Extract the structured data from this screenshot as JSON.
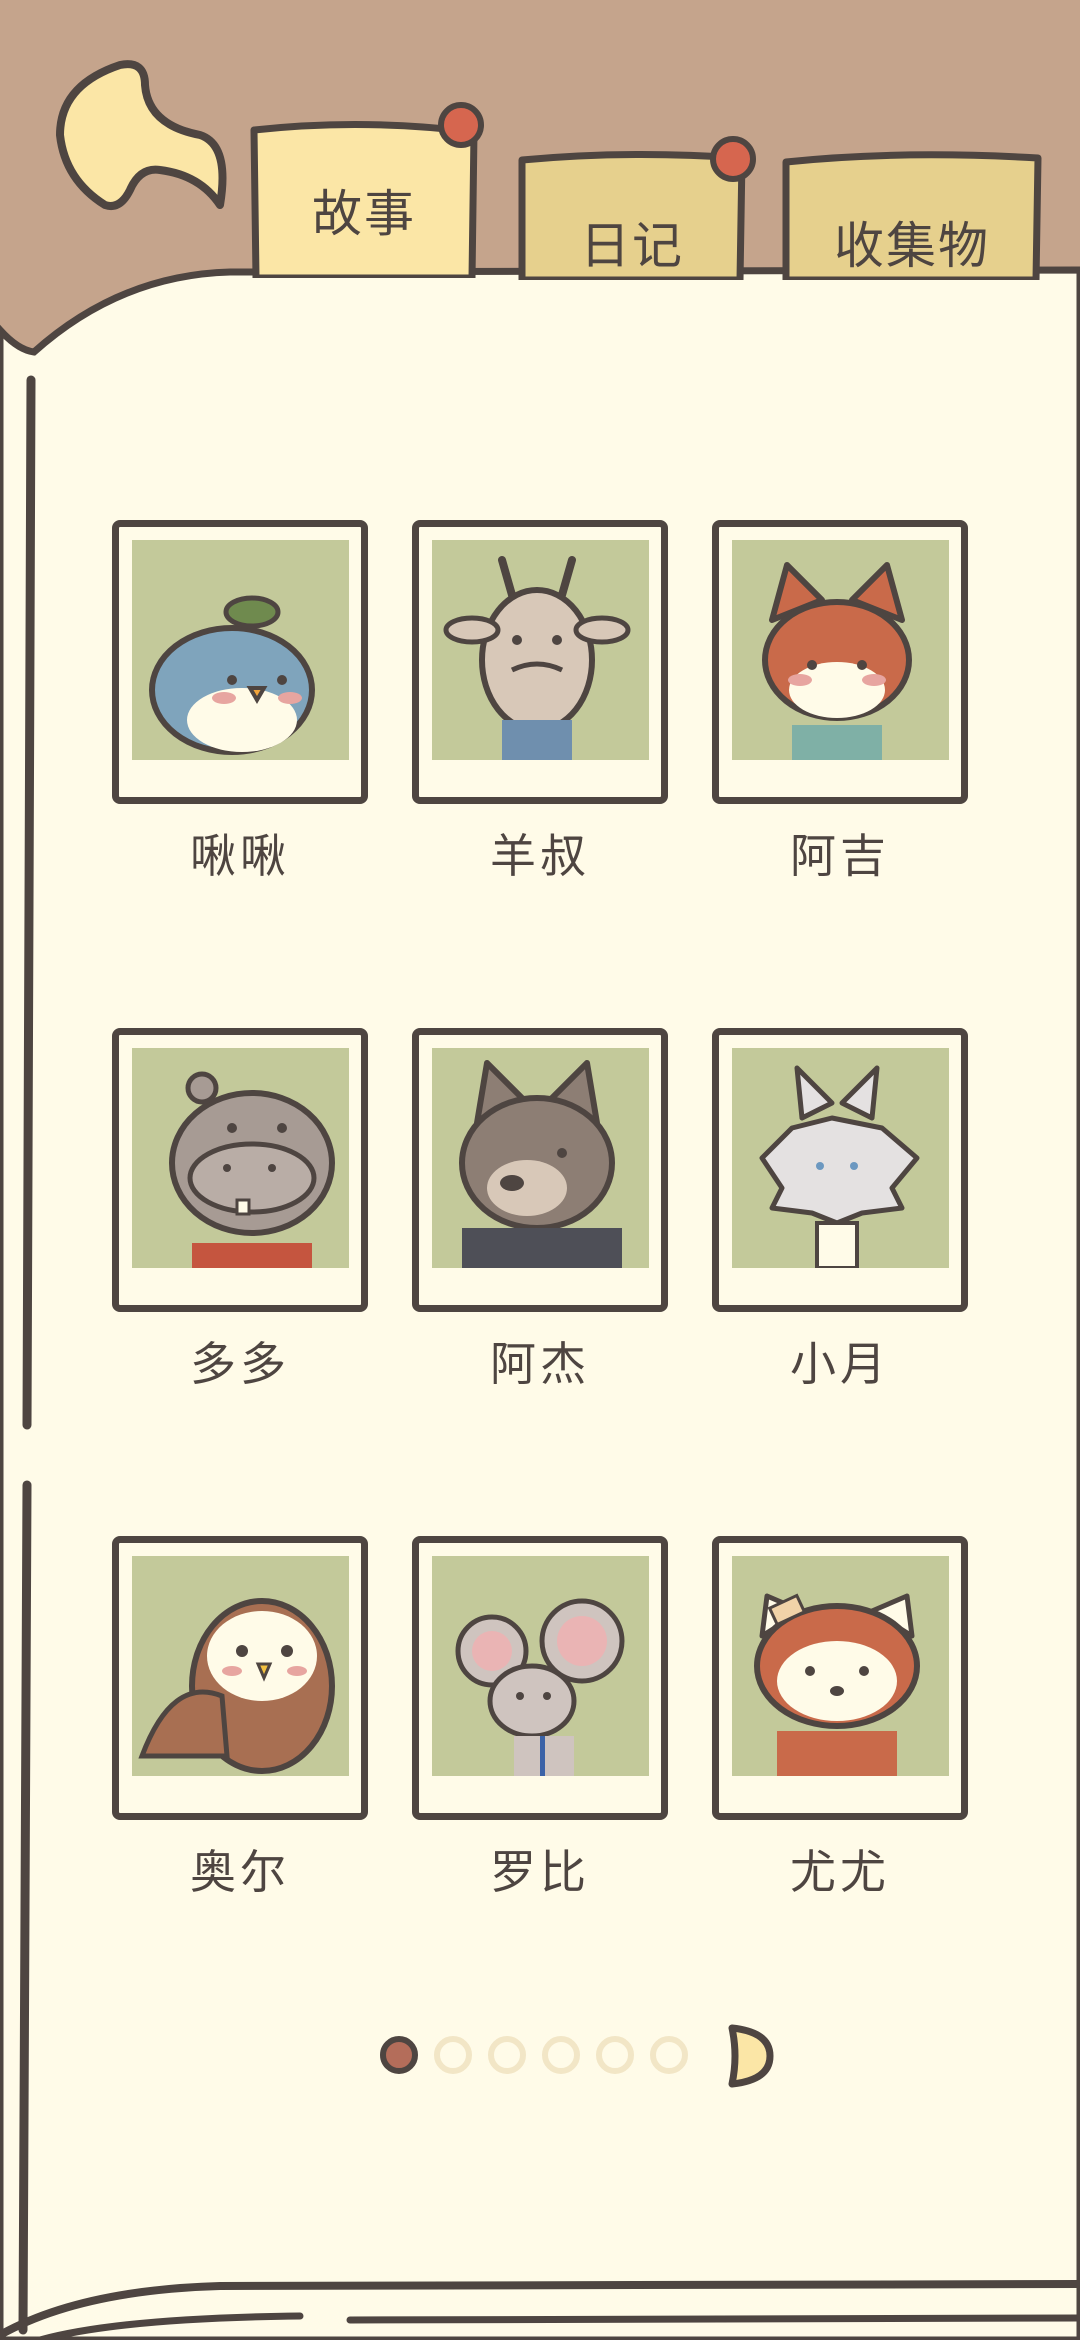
{
  "tabs": [
    {
      "label": "故事",
      "active": true,
      "has_badge": true
    },
    {
      "label": "日记",
      "active": false,
      "has_badge": true
    },
    {
      "label": "收集物",
      "active": false,
      "has_badge": false
    }
  ],
  "characters": [
    {
      "name": "啾啾",
      "icon": "blue-bird-icon"
    },
    {
      "name": "羊叔",
      "icon": "goat-icon"
    },
    {
      "name": "阿吉",
      "icon": "fox-icon"
    },
    {
      "name": "多多",
      "icon": "hippo-icon"
    },
    {
      "name": "阿杰",
      "icon": "wolf-icon"
    },
    {
      "name": "小月",
      "icon": "white-cat-icon"
    },
    {
      "name": "奥尔",
      "icon": "owl-icon"
    },
    {
      "name": "罗比",
      "icon": "mouse-icon"
    },
    {
      "name": "尤尤",
      "icon": "red-panda-icon"
    }
  ],
  "pagination": {
    "current_page": 1,
    "total_pages": 6
  },
  "colors": {
    "outline": "#4e4541",
    "page": "#fffbe8",
    "frame_bg": "#c3c99a",
    "tab_active": "#fbe6a6",
    "tab_inactive": "#e6d08d",
    "badge": "#d6664f"
  }
}
